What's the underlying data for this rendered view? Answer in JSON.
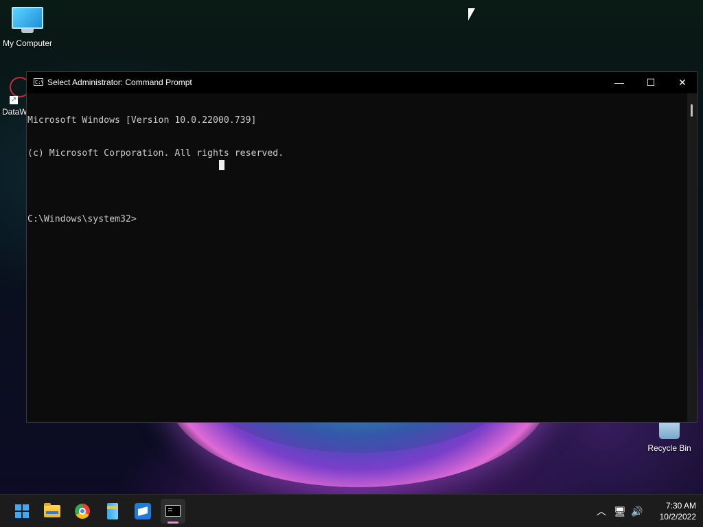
{
  "desktop": {
    "icons": [
      {
        "label": "My Computer",
        "icon": "computer-icon"
      },
      {
        "label": "DataW",
        "icon": "datawarehouse-shortcut-icon"
      },
      {
        "label": "Recycle Bin",
        "icon": "recycle-bin-icon"
      }
    ]
  },
  "cmd_window": {
    "title": "Select Administrator: Command Prompt",
    "icon": "console-app-icon",
    "icon_glyph": "C:\\",
    "buttons": {
      "minimize": "—",
      "maximize": "☐",
      "close": "✕"
    },
    "lines": [
      "Microsoft Windows [Version 10.0.22000.739]",
      "(c) Microsoft Corporation. All rights reserved.",
      "",
      "C:\\Windows\\system32>"
    ]
  },
  "taskbar": {
    "apps": [
      {
        "name": "start",
        "icon": "windows-start-icon"
      },
      {
        "name": "file-explorer",
        "icon": "folder-icon"
      },
      {
        "name": "chrome",
        "icon": "chrome-icon"
      },
      {
        "name": "archiver",
        "icon": "archive-icon"
      },
      {
        "name": "box-app",
        "icon": "box-icon"
      },
      {
        "name": "command-prompt",
        "icon": "terminal-icon",
        "active": true
      }
    ],
    "tray": {
      "chevron": "︿",
      "network": "🖥",
      "volume": "🔊"
    },
    "clock": {
      "time": "7:30 AM",
      "date": "10/2/2022"
    }
  },
  "colors": {
    "console_bg": "#0c0c0c",
    "console_text": "#cccccc",
    "taskbar_bg": "#1c1c1c",
    "start_blue": "#3fa9f5"
  }
}
